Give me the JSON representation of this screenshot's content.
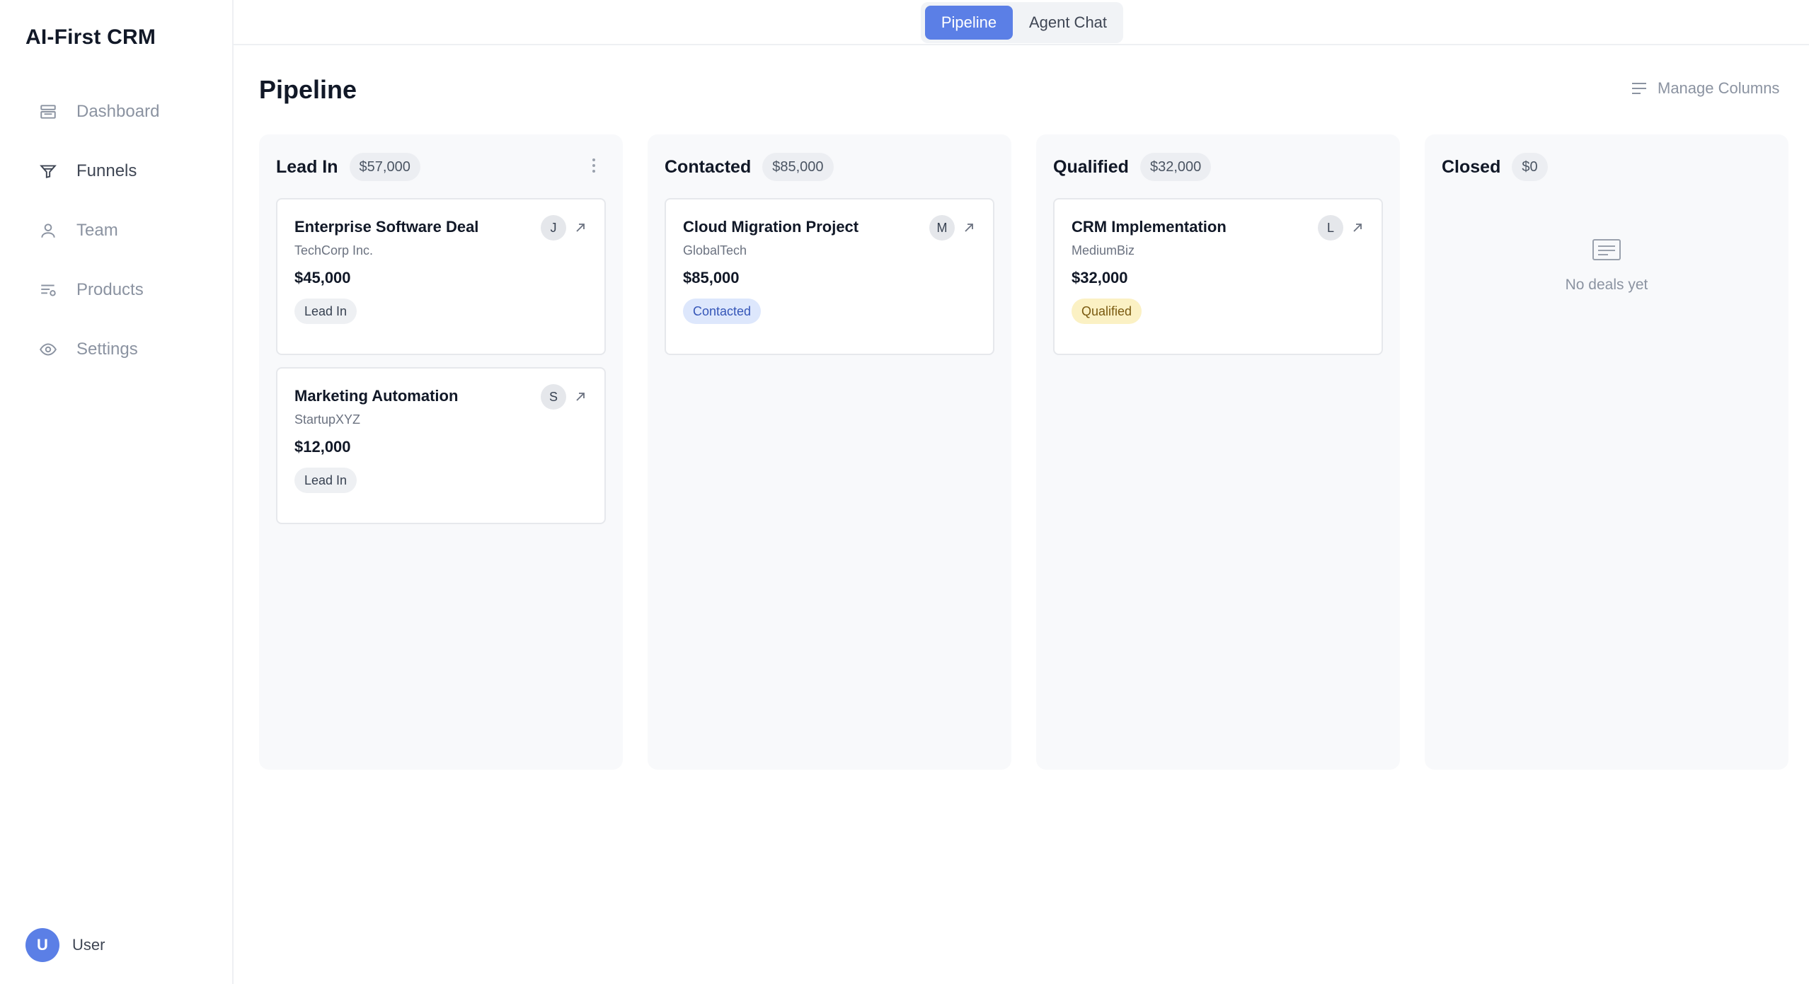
{
  "app": {
    "brand": "AI-First CRM"
  },
  "sidebar": {
    "items": [
      {
        "label": "Dashboard",
        "icon": "dashboard-icon"
      },
      {
        "label": "Funnels",
        "icon": "funnel-icon"
      },
      {
        "label": "Team",
        "icon": "user-icon"
      },
      {
        "label": "Products",
        "icon": "products-icon"
      },
      {
        "label": "Settings",
        "icon": "eye-icon"
      }
    ],
    "active": "Funnels",
    "user": {
      "initial": "U",
      "name": "User"
    }
  },
  "topbar": {
    "tabs": [
      "Pipeline",
      "Agent Chat"
    ],
    "active": "Pipeline"
  },
  "header": {
    "title": "Pipeline",
    "manage_label": "Manage Columns"
  },
  "columns": [
    {
      "title": "Lead In",
      "total": "$57,000",
      "cards": [
        {
          "title": "Enterprise Software Deal",
          "company": "TechCorp Inc.",
          "amount": "$45,000",
          "stage": "Lead In",
          "owner": "J"
        },
        {
          "title": "Marketing Automation",
          "company": "StartupXYZ",
          "amount": "$12,000",
          "stage": "Lead In",
          "owner": "S"
        }
      ]
    },
    {
      "title": "Contacted",
      "total": "$85,000",
      "cards": [
        {
          "title": "Cloud Migration Project",
          "company": "GlobalTech",
          "amount": "$85,000",
          "stage": "Contacted",
          "owner": "M"
        }
      ]
    },
    {
      "title": "Qualified",
      "total": "$32,000",
      "cards": [
        {
          "title": "CRM Implementation",
          "company": "MediumBiz",
          "amount": "$32,000",
          "stage": "Qualified",
          "owner": "L"
        }
      ]
    },
    {
      "title": "Closed",
      "total": "$0",
      "empty_text": "No deals yet"
    }
  ],
  "colors": {
    "accent": "#5b7fe6",
    "contacted_badge": "#dde7fc",
    "qualified_badge": "#fbf1c4"
  }
}
